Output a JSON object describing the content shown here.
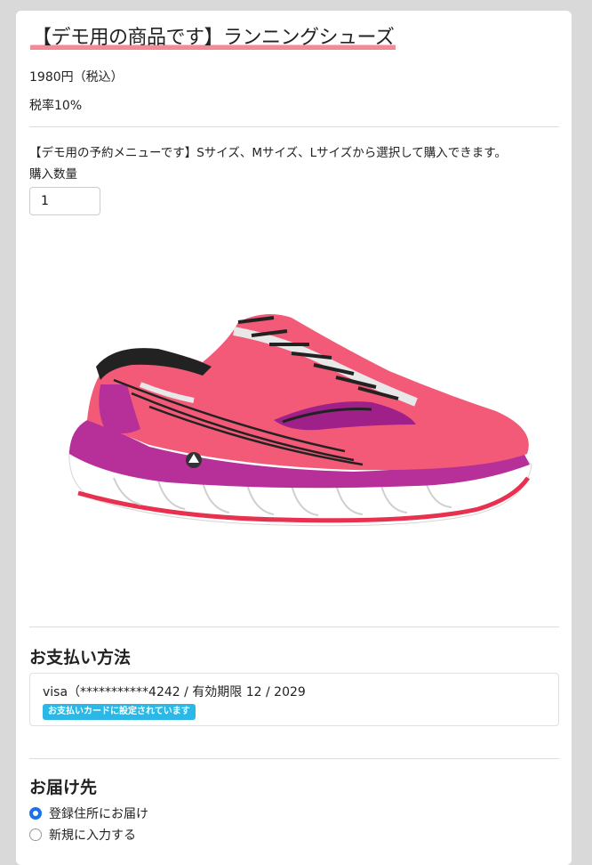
{
  "product": {
    "title": "【デモ用の商品です】ランニングシューズ",
    "price": "1980円（税込）",
    "tax_rate": "税率10%",
    "description": "【デモ用の予約メニューです】Sサイズ、Mサイズ、Lサイズから選択して購入できます。",
    "quantity_label": "購入数量",
    "quantity_value": "1",
    "image_icon": "running-shoe-image"
  },
  "payment": {
    "section_title": "お支払い方法",
    "card_text": "visa（***********4242 / 有効期限 12 / 2029",
    "badge": "お支払いカードに設定されています"
  },
  "delivery": {
    "section_title": "お届け先",
    "options": [
      {
        "label": "登録住所にお届け",
        "selected": true
      },
      {
        "label": "新規に入力する",
        "selected": false
      }
    ]
  },
  "colors": {
    "title_underline": "#f48a96",
    "badge": "#2bb8e6",
    "radio_selected": "#1a73e8"
  }
}
